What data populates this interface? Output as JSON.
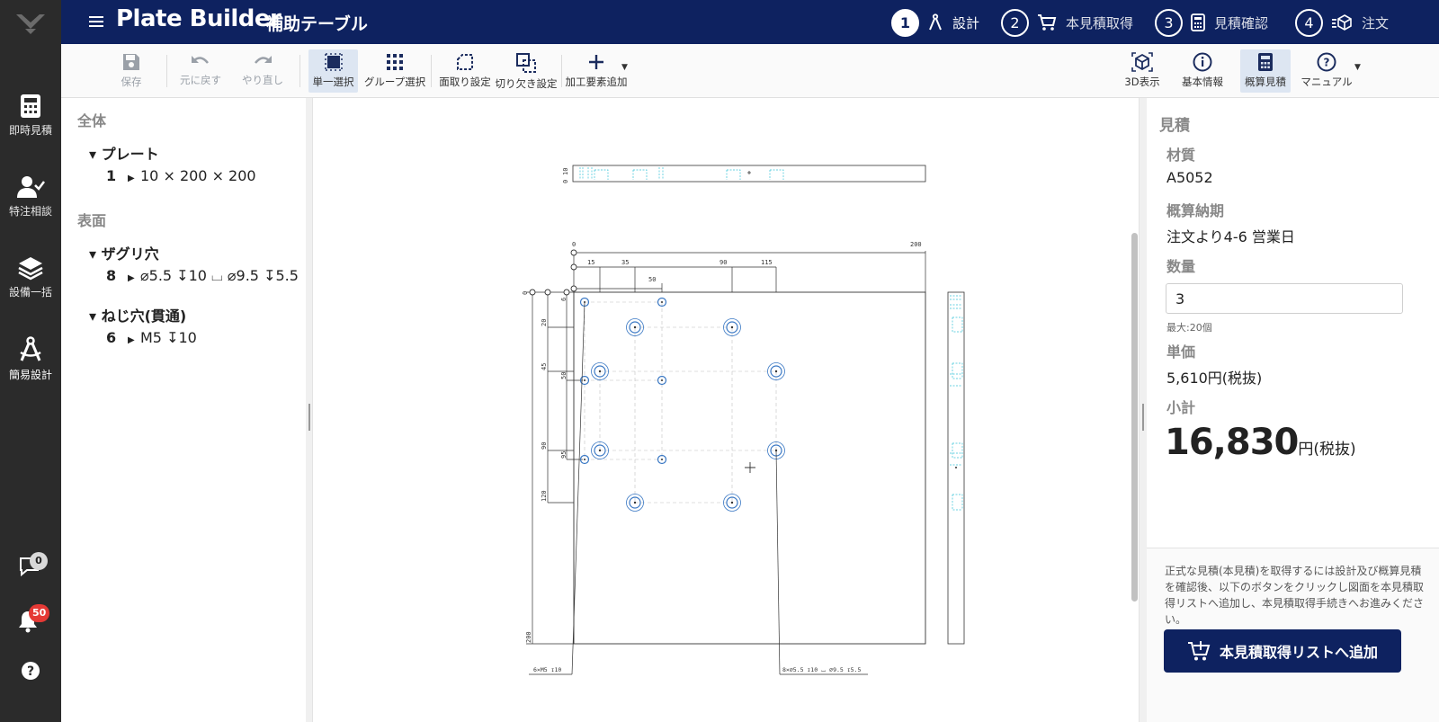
{
  "header": {
    "app_title": "Plate Builder",
    "app_subtitle": "補助テーブル",
    "steps": [
      {
        "num": "1",
        "label": "設計",
        "icon": "compass-icon",
        "active": true
      },
      {
        "num": "2",
        "label": "本見積取得",
        "icon": "cart-icon",
        "active": false
      },
      {
        "num": "3",
        "label": "見積確認",
        "icon": "calculator-icon",
        "active": false
      },
      {
        "num": "4",
        "label": "注文",
        "icon": "box-icon",
        "active": false
      }
    ]
  },
  "rail": {
    "items": [
      {
        "label": "即時見積",
        "icon": "calculator-icon"
      },
      {
        "label": "特注相談",
        "icon": "user-check-icon"
      },
      {
        "label": "設備一括",
        "icon": "layers-icon"
      },
      {
        "label": "簡易設計",
        "icon": "compass-icon"
      }
    ],
    "chat_count": "0",
    "notification_count": "50"
  },
  "toolbar": {
    "save": "保存",
    "undo": "元に戻す",
    "redo": "やり直し",
    "single_select": "単一選択",
    "group_select": "グループ選択",
    "chamfer": "面取り設定",
    "notch": "切り欠き設定",
    "add_feature": "加工要素追加",
    "view_3d": "3D表示",
    "basic_info": "基本情報",
    "estimate": "概算見積",
    "manual": "マニュアル"
  },
  "tree": {
    "section_all": "全体",
    "plate_group": "プレート",
    "plate_idx": "1",
    "plate_dims": "10 × 200 × 200",
    "section_surface": "表面",
    "counterbore_group": "ザグリ穴",
    "counterbore_idx": "8",
    "counterbore_spec": "⌀5.5 ↧10 ⌴ ⌀9.5 ↧5.5",
    "tapped_group": "ねじ穴(貫通)",
    "tapped_idx": "6",
    "tapped_spec": "M5 ↧10"
  },
  "drawing": {
    "top_zero": "0",
    "top_200": "200",
    "x15": "15",
    "x35": "35",
    "x50": "50",
    "x90": "90",
    "x115": "115",
    "y20": "20",
    "y45": "45",
    "y50": "50",
    "y90": "90",
    "y95": "95",
    "y120": "120",
    "y200": "200",
    "y6": "6",
    "side_zero": "0",
    "side_ten": "10",
    "left_zero": "0",
    "tap_note": "6×M5 ↧10",
    "cb_note": "8×⌀5.5 ↧10 ⌴ ⌀9.5 ↧5.5"
  },
  "estimate": {
    "title": "見積",
    "material_label": "材質",
    "material": "A5052",
    "leadtime_label": "概算納期",
    "leadtime": "注文より4-6 営業日",
    "qty_label": "数量",
    "qty": "3",
    "qty_max": "最大:20個",
    "unit_price_label": "単価",
    "unit_price": "5,610円(税抜)",
    "subtotal_label": "小計",
    "subtotal": "16,830",
    "subtotal_unit": "円(税抜)",
    "note": "正式な見積(本見積)を取得するには設計及び概算見積を確認後、以下のボタンをクリックし図面を本見積取得リストへ追加し、本見積取得手続きへお進みください。",
    "add_button": "本見積取得リストへ追加"
  },
  "colors": {
    "brand": "#0e2260",
    "rail": "#2b2b2b",
    "hole": "#3a78c4",
    "hidden_line": "#37c4d8",
    "alert": "#e53935"
  }
}
